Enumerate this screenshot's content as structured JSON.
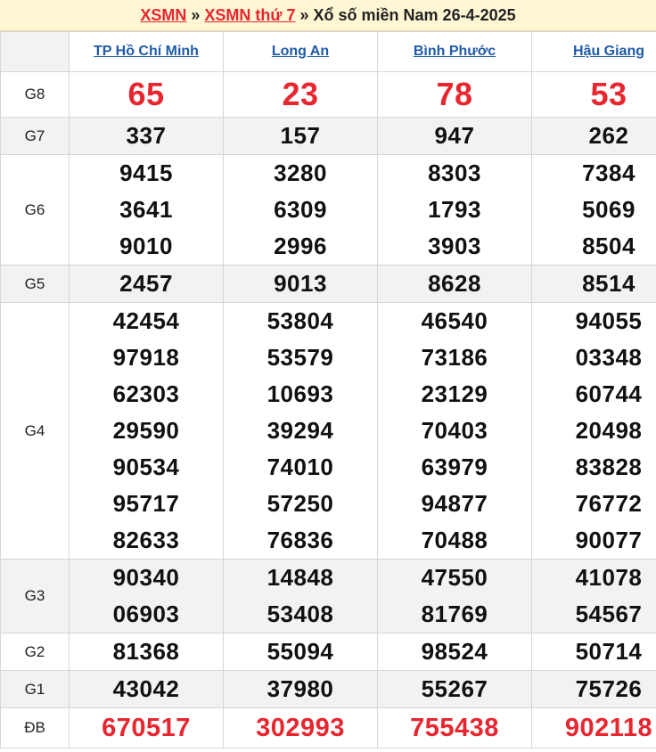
{
  "header": {
    "link1": "XSMN",
    "sep1": "»",
    "link2": "XSMN thứ 7",
    "sep2": "»",
    "title": "Xổ số miền Nam 26-4-2025"
  },
  "provinces": [
    "TP Hồ Chí Minh",
    "Long An",
    "Bình Phước",
    "Hậu Giang"
  ],
  "prizes": [
    {
      "label": "G8",
      "values": [
        [
          "65"
        ],
        [
          "23"
        ],
        [
          "78"
        ],
        [
          "53"
        ]
      ]
    },
    {
      "label": "G7",
      "values": [
        [
          "337"
        ],
        [
          "157"
        ],
        [
          "947"
        ],
        [
          "262"
        ]
      ]
    },
    {
      "label": "G6",
      "values": [
        [
          "9415",
          "3641",
          "9010"
        ],
        [
          "3280",
          "6309",
          "2996"
        ],
        [
          "8303",
          "1793",
          "3903"
        ],
        [
          "7384",
          "5069",
          "8504"
        ]
      ]
    },
    {
      "label": "G5",
      "values": [
        [
          "2457"
        ],
        [
          "9013"
        ],
        [
          "8628"
        ],
        [
          "8514"
        ]
      ]
    },
    {
      "label": "G4",
      "values": [
        [
          "42454",
          "97918",
          "62303",
          "29590",
          "90534",
          "95717",
          "82633"
        ],
        [
          "53804",
          "53579",
          "10693",
          "39294",
          "74010",
          "57250",
          "76836"
        ],
        [
          "46540",
          "73186",
          "23129",
          "70403",
          "63979",
          "94877",
          "70488"
        ],
        [
          "94055",
          "03348",
          "60744",
          "20498",
          "83828",
          "76772",
          "90077"
        ]
      ]
    },
    {
      "label": "G3",
      "values": [
        [
          "90340",
          "06903"
        ],
        [
          "14848",
          "53408"
        ],
        [
          "47550",
          "81769"
        ],
        [
          "41078",
          "54567"
        ]
      ]
    },
    {
      "label": "G2",
      "values": [
        [
          "81368"
        ],
        [
          "55094"
        ],
        [
          "98524"
        ],
        [
          "50714"
        ]
      ]
    },
    {
      "label": "G1",
      "values": [
        [
          "43042"
        ],
        [
          "37980"
        ],
        [
          "55267"
        ],
        [
          "75726"
        ]
      ]
    },
    {
      "label": "ĐB",
      "values": [
        [
          "670517"
        ],
        [
          "302993"
        ],
        [
          "755438"
        ],
        [
          "902118"
        ]
      ]
    }
  ],
  "colors": {
    "accent_red": "#e8262f",
    "link_blue": "#1f5ba8",
    "header_bg": "#fff6d4",
    "alt_row_bg": "#f2f2f2"
  }
}
